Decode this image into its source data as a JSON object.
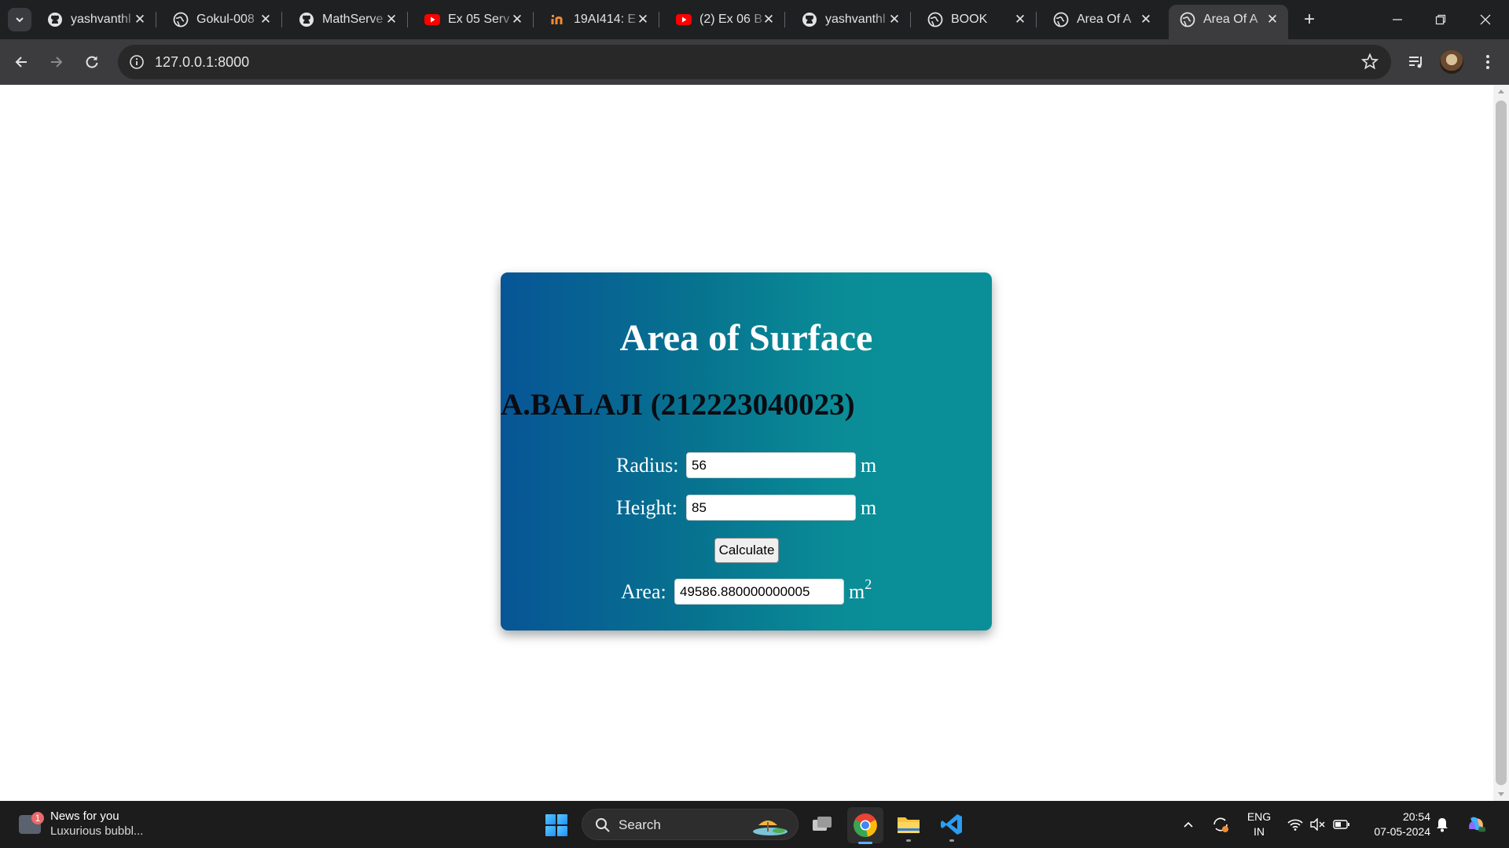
{
  "browser": {
    "tabs": [
      {
        "title": "yashvanthl",
        "icon": "github-icon"
      },
      {
        "title": "Gokul-008",
        "icon": "globe-icon"
      },
      {
        "title": "MathServe",
        "icon": "github-icon"
      },
      {
        "title": "Ex 05 Serv",
        "icon": "youtube-icon"
      },
      {
        "title": "19AI414: E",
        "icon": "iamneo-icon"
      },
      {
        "title": "(2) Ex 06 B",
        "icon": "youtube-icon"
      },
      {
        "title": "yashvanthl",
        "icon": "github-icon"
      },
      {
        "title": "BOOK",
        "icon": "globe-icon"
      },
      {
        "title": "Area Of A",
        "icon": "globe-icon"
      },
      {
        "title": "Area Of A",
        "icon": "globe-icon",
        "active": true
      }
    ],
    "address": "127.0.0.1:8000"
  },
  "page": {
    "title": "Area of Surface",
    "author": "A.BALAJI (212223040023)",
    "radius": {
      "label": "Radius:",
      "value": "56",
      "unit": "m"
    },
    "height": {
      "label": "Height:",
      "value": "85",
      "unit": "m"
    },
    "calculate_label": "Calculate",
    "area": {
      "label": "Area:",
      "value": "49586.880000000005",
      "unit": "m",
      "unit_power": "2"
    }
  },
  "taskbar": {
    "news_badge": "1",
    "news_title": "News for you",
    "news_subtitle": "Luxurious bubbl...",
    "search_label": "Search",
    "lang_line1": "ENG",
    "lang_line2": "IN",
    "time": "20:54",
    "date": "07-05-2024"
  },
  "colors": {
    "card_gradient_start": "#075596",
    "card_gradient_end": "#0a8f98",
    "author_text": "#0b0b12",
    "browser_dark": "#1f2022"
  }
}
